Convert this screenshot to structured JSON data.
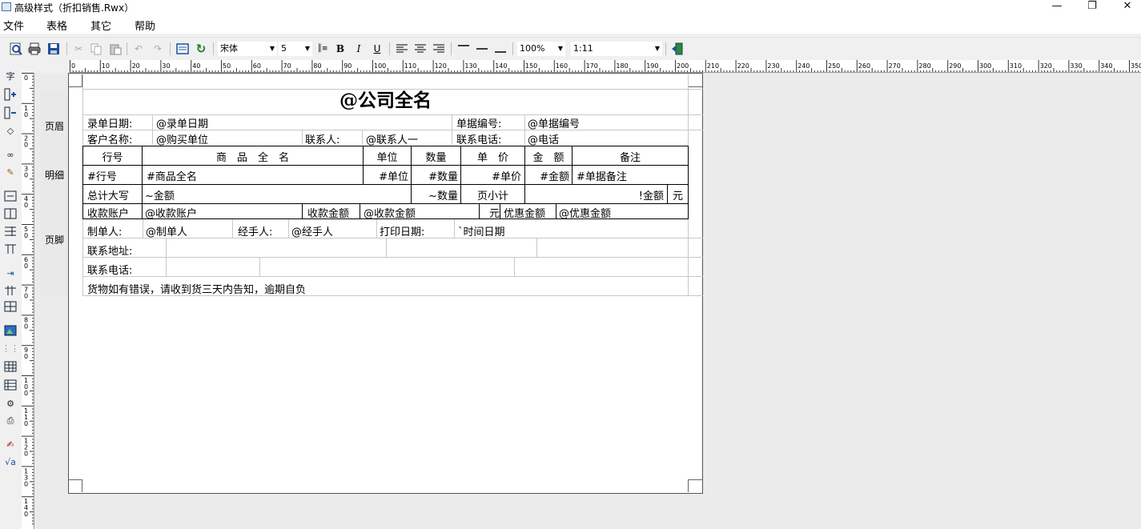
{
  "window": {
    "title": "高级样式（折扣销售.Rwx）",
    "minimize": "—",
    "restore": "❐",
    "close": "✕"
  },
  "menu": [
    "文件",
    "表格",
    "其它",
    "帮助"
  ],
  "toolbar": {
    "font": "宋体",
    "size": "5",
    "zoom": "100%",
    "scale": "1:11",
    "bold": "B",
    "italic": "I",
    "underline": "U"
  },
  "ruler": {
    "h": [
      "0",
      "10",
      "20",
      "30",
      "40",
      "50",
      "60",
      "70",
      "80",
      "90",
      "100",
      "110",
      "120",
      "130",
      "140",
      "150",
      "160",
      "170",
      "180",
      "190",
      "200",
      "210",
      "220",
      "230",
      "240",
      "250",
      "260",
      "270",
      "280",
      "290",
      "300",
      "310",
      "320",
      "330",
      "340",
      "350"
    ],
    "v": [
      "0",
      "10",
      "20",
      "30",
      "40",
      "50",
      "60",
      "70",
      "80",
      "90",
      "100",
      "110",
      "120",
      "130",
      "140"
    ]
  },
  "bands": {
    "header": "页眉",
    "detail": "明细",
    "footer": "页脚"
  },
  "report": {
    "title": "@公司全名",
    "row1": {
      "date_label": "录单日期:",
      "date_value": "@录单日期",
      "no_label": "单据编号:",
      "no_value": "@单据编号"
    },
    "row2": {
      "cust_label": "客户名称:",
      "cust_value": "@购买单位",
      "contact_label": "联系人:",
      "contact_value": "@联系人一",
      "phone_label": "联系电话:",
      "phone_value": "@电话"
    },
    "cols": [
      "行号",
      "商　品　全　名",
      "单位",
      "数量",
      "单　价",
      "金　额",
      "备注"
    ],
    "detail": [
      "#行号",
      "#商品全名",
      "#单位",
      "#数量",
      "#单价",
      "#金额",
      "#单据备注"
    ],
    "total": {
      "label": "总计大写",
      "amount_upper": "~金额",
      "qty": "~数量",
      "subtotal_label": "页小计",
      "amount": "!金额",
      "unit": "元"
    },
    "pay": {
      "acct_label": "收款账户",
      "acct_value": "@收款账户",
      "recv_label": "收款金额",
      "recv_value": "@收款金额",
      "unit": "元",
      "disc_label": "优惠金额",
      "disc_value": "@优惠金额"
    },
    "foot1": {
      "maker_label": "制单人:",
      "maker_value": "@制单人",
      "handler_label": "经手人:",
      "handler_value": "@经手人",
      "print_label": "打印日期:",
      "print_value": "`时间日期"
    },
    "foot2": {
      "addr_label": "联系地址:"
    },
    "foot3": {
      "phone_label": "联系电话:"
    },
    "foot4": {
      "note": "货物如有错误，请收到货三天内告知，逾期自负"
    }
  }
}
